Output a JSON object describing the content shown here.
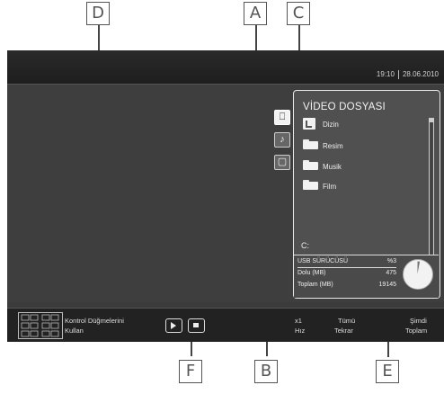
{
  "callouts": {
    "a": "A",
    "b": "B",
    "c": "C",
    "d": "D",
    "e": "E",
    "f": "F"
  },
  "header": {
    "time": "19:10",
    "date": "28.06.2010"
  },
  "tabs": [
    {
      "name": "video-tab",
      "icon": "film-icon",
      "active": true
    },
    {
      "name": "music-tab",
      "icon": "music-note-icon",
      "active": false
    },
    {
      "name": "photo-tab",
      "icon": "picture-icon",
      "active": false
    }
  ],
  "panel": {
    "title": "VİDEO DOSYASI",
    "items": [
      {
        "label": "Dizin",
        "icon": "directory-up-icon"
      },
      {
        "label": "Resim",
        "icon": "folder-icon"
      },
      {
        "label": "Musik",
        "icon": "folder-icon"
      },
      {
        "label": "Film",
        "icon": "folder-icon"
      }
    ],
    "drive": "C:",
    "stats": [
      {
        "label": "USB SÜRÜCÜSÜ",
        "value": "%3"
      },
      {
        "label": "Dolu (MB)",
        "value": "475"
      },
      {
        "label": "Toplam (MB)",
        "value": "19145"
      }
    ],
    "gauge_used_fraction": 0.03
  },
  "bottom": {
    "help_line1": "Kontrol Düğmelerini",
    "help_line2": "Kullan",
    "speed_value": "x1",
    "speed_label": "Hız",
    "repeat_value": "Tümü",
    "repeat_label": "Tekrar",
    "time_value": "Şimdi",
    "time_label": "Toplam"
  },
  "colors": {
    "screen_bg": "#3e3e3e",
    "panel_bg": "#505050",
    "bar_bg": "#222222",
    "text": "#eeeeee"
  }
}
